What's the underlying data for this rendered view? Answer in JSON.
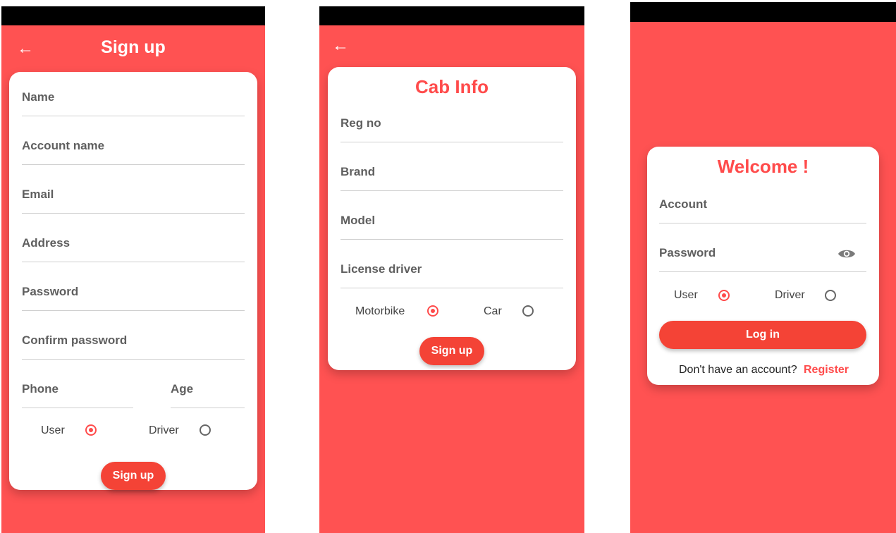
{
  "signup": {
    "title": "Sign up",
    "fields": {
      "name": "Name",
      "account_name": "Account name",
      "email": "Email",
      "address": "Address",
      "password": "Password",
      "confirm_password": "Confirm password",
      "phone": "Phone",
      "age": "Age"
    },
    "role_user": "User",
    "role_driver": "Driver",
    "role_selected": "User",
    "button": "Sign up"
  },
  "cab": {
    "title": "Cab Info",
    "fields": {
      "reg_no": "Reg no",
      "brand": "Brand",
      "model": "Model",
      "license": "License driver"
    },
    "type_motorbike": "Motorbike",
    "type_car": "Car",
    "type_selected": "Motorbike",
    "button": "Sign up"
  },
  "login": {
    "title": "Welcome !",
    "fields": {
      "account": "Account",
      "password": "Password"
    },
    "role_user": "User",
    "role_driver": "Driver",
    "role_selected": "User",
    "button": "Log in",
    "no_account": "Don't have an account?",
    "register": "Register"
  },
  "colors": {
    "primary": "#ff5252",
    "accent": "#f44336",
    "statusbar": "#000000"
  },
  "icons": {
    "back": "arrow-left",
    "visibility": "eye"
  }
}
